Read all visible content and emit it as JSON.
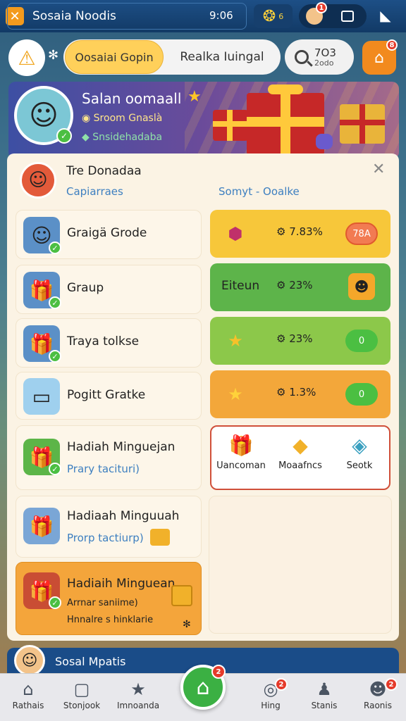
{
  "topbar": {
    "close_icon": "close-icon",
    "title": "Sosaia Noodis",
    "time": "9:06",
    "coin_count": "6",
    "notif_count": "1"
  },
  "header": {
    "tab_active": "Oosaiai Gopin",
    "tab_inactive": "Realka Iuingal",
    "search_line1": "7O3",
    "search_line2": "2odo",
    "home_badge": "8"
  },
  "banner": {
    "name": "Salan oomaall",
    "sub1": "Sroom Gnaslà",
    "sub2": "Snsidehadaba"
  },
  "panel": {
    "title": "Tre Donadaa",
    "sub_left": "Capiarraes",
    "sub_right": "Somyt - Ooalke",
    "left_items": [
      {
        "label": "Graigä Grode",
        "sub": ""
      },
      {
        "label": "Graup",
        "sub": ""
      },
      {
        "label": "Traya tolkse",
        "sub": ""
      },
      {
        "label": "Pogitt Gratke",
        "sub": ""
      },
      {
        "label": "Hadiah Minguejan",
        "sub": "Prary tacituri)"
      },
      {
        "label": "Hadiaah Minguuah",
        "sub": "Prorp tactiurp)"
      },
      {
        "label": "Hadiaih Minguean",
        "sub": "Arrnar saniime)",
        "sub2": "Hnnalre s hinklarie"
      }
    ],
    "right_items": [
      {
        "label": "",
        "pct": "7.83%",
        "pill": "78A",
        "color": "#f7c73a",
        "pill_bg": "#f27b52",
        "pill_color": "#fff"
      },
      {
        "label": "Eiteun",
        "pct": "23%",
        "pill": "",
        "color": "#5db44a"
      },
      {
        "label": "",
        "pct": "23%",
        "pill": "0",
        "color": "#8cc84a",
        "pill_bg": "#4bbf42",
        "pill_color": "#fff"
      },
      {
        "label": "",
        "pct": "1.3%",
        "pill": "0",
        "color": "#f3a73a",
        "pill_bg": "#4bbf42",
        "pill_color": "#fff"
      }
    ],
    "rewards": [
      "Uancoman",
      "Moaafncs",
      "Seotk"
    ]
  },
  "bottom": {
    "strip_title": "Sosal Mpatis",
    "nav": [
      {
        "label": "Rathais",
        "icon": "home-icon"
      },
      {
        "label": "Stonjook",
        "icon": "chat-icon"
      },
      {
        "label": "Imnoanda",
        "icon": "star-icon"
      },
      {
        "label": "Hing",
        "icon": "search-icon",
        "badge": "2"
      },
      {
        "label": "Stanis",
        "icon": "user-icon"
      },
      {
        "label": "Raonis",
        "icon": "profile-icon",
        "badge": "2"
      }
    ],
    "center_badge": "2"
  },
  "colors": {
    "brand_blue": "#1d4f86",
    "accent_yellow": "#ffd05a",
    "accent_orange": "#f28a1e",
    "success_green": "#3bb043"
  }
}
